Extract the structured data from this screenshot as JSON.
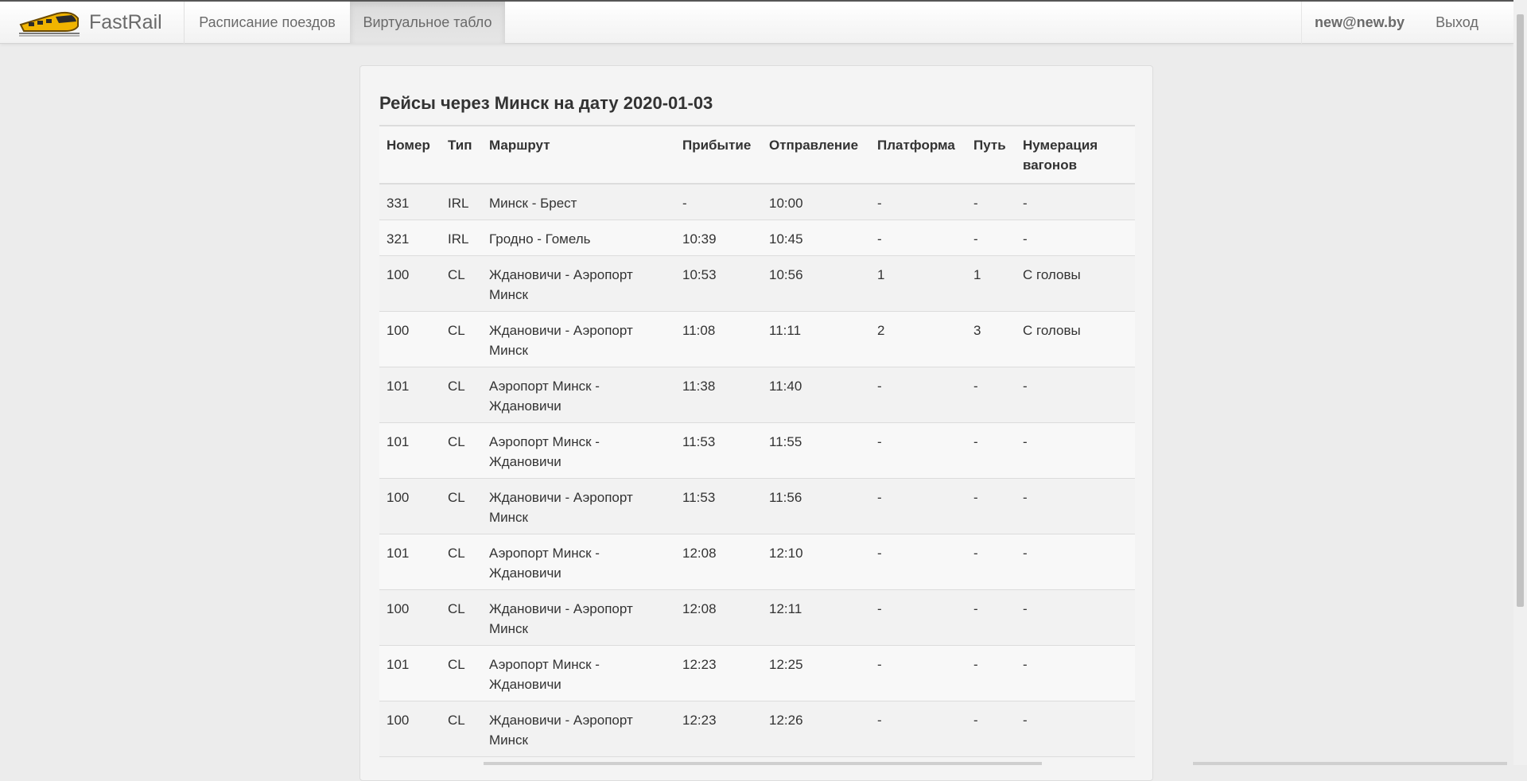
{
  "navbar": {
    "brand": "FastRail",
    "schedule_label": "Расписание поездов",
    "board_label": "Виртуальное табло",
    "user_label": "new@new.by",
    "logout_label": "Выход",
    "logo_icon": "train-icon",
    "logo_color": "#f0b400"
  },
  "board": {
    "title": "Рейсы через Минск на дату 2020-01-03",
    "columns": [
      "Номер",
      "Тип",
      "Маршрут",
      "Прибытие",
      "Отправление",
      "Платформа",
      "Путь",
      "Нумерация вагонов"
    ],
    "rows": [
      [
        "331",
        "IRL",
        "Минск - Брест",
        "-",
        "10:00",
        "-",
        "-",
        "-"
      ],
      [
        "321",
        "IRL",
        "Гродно - Гомель",
        "10:39",
        "10:45",
        "-",
        "-",
        "-"
      ],
      [
        "100",
        "CL",
        "Ждановичи - Аэропорт Минск",
        "10:53",
        "10:56",
        "1",
        "1",
        "С головы"
      ],
      [
        "100",
        "CL",
        "Ждановичи - Аэропорт Минск",
        "11:08",
        "11:11",
        "2",
        "3",
        "С головы"
      ],
      [
        "101",
        "CL",
        "Аэропорт Минск - Ждановичи",
        "11:38",
        "11:40",
        "-",
        "-",
        "-"
      ],
      [
        "101",
        "CL",
        "Аэропорт Минск - Ждановичи",
        "11:53",
        "11:55",
        "-",
        "-",
        "-"
      ],
      [
        "100",
        "CL",
        "Ждановичи - Аэропорт Минск",
        "11:53",
        "11:56",
        "-",
        "-",
        "-"
      ],
      [
        "101",
        "CL",
        "Аэропорт Минск - Ждановичи",
        "12:08",
        "12:10",
        "-",
        "-",
        "-"
      ],
      [
        "100",
        "CL",
        "Ждановичи - Аэропорт Минск",
        "12:08",
        "12:11",
        "-",
        "-",
        "-"
      ],
      [
        "101",
        "CL",
        "Аэропорт Минск - Ждановичи",
        "12:23",
        "12:25",
        "-",
        "-",
        "-"
      ],
      [
        "100",
        "CL",
        "Ждановичи - Аэропорт Минск",
        "12:23",
        "12:26",
        "-",
        "-",
        "-"
      ]
    ]
  }
}
